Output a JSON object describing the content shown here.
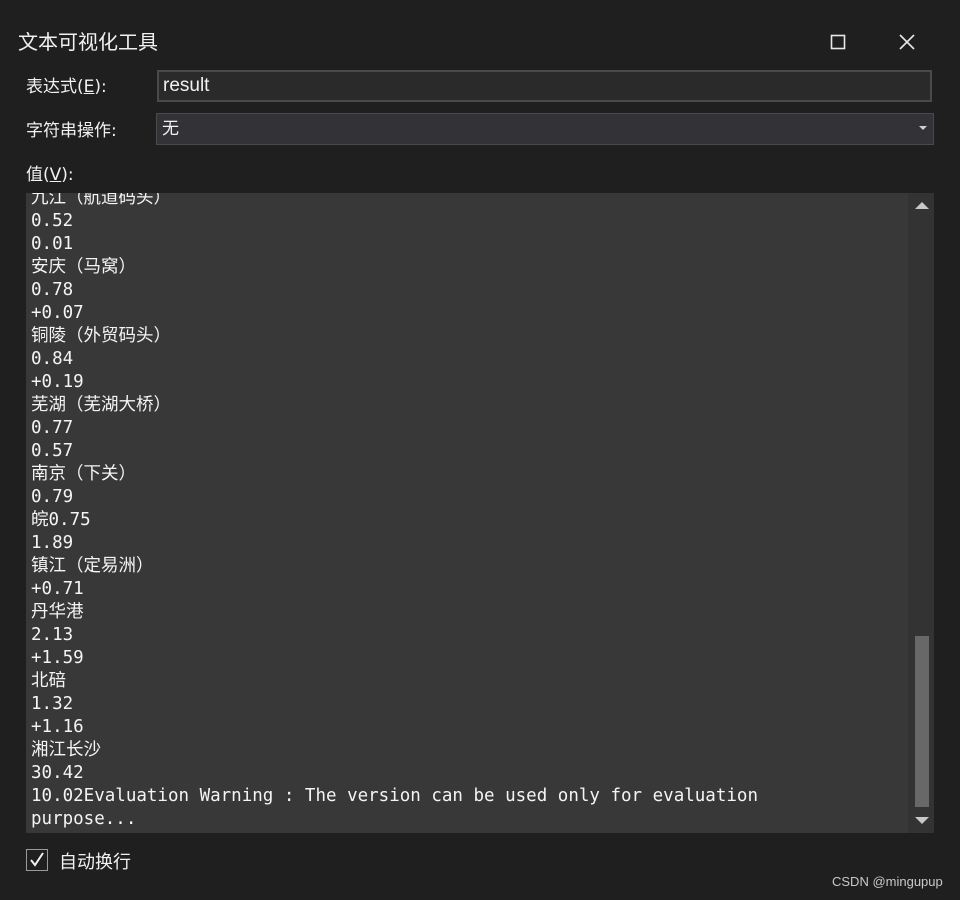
{
  "window": {
    "title": "文本可视化工具",
    "maximize_icon": "maximize-icon",
    "close_icon": "close-icon"
  },
  "expression": {
    "label_prefix": "表达式(",
    "label_accel": "E",
    "label_suffix": "):",
    "value": "result"
  },
  "string_operation": {
    "label": "字符串操作:",
    "selected": "无",
    "dropdown_icon": "chevron-down-icon"
  },
  "value_section": {
    "label_prefix": "值(",
    "label_accel": "V",
    "label_suffix": "):",
    "lines": [
      "九江（航道码头）",
      "0.52",
      "0.01",
      "安庆（马窝）",
      "0.78",
      "+0.07",
      "铜陵（外贸码头）",
      "0.84",
      "+0.19",
      "芜湖（芜湖大桥）",
      "0.77",
      "0.57",
      "南京（下关）",
      "0.79",
      "皖0.75",
      "1.89",
      "镇江（定易洲）",
      "+0.71",
      "丹华港",
      "2.13",
      "+1.59",
      "北碚",
      "1.32",
      "+1.16",
      "湘江长沙",
      "30.42",
      "10.02Evaluation Warning : The version can be used only for evaluation",
      "purpose..."
    ]
  },
  "word_wrap": {
    "label": "自动换行",
    "checked": true
  },
  "watermark": "CSDN @mingupup",
  "colors": {
    "background": "#1f1f1f",
    "text_area": "#383838",
    "scroll_thumb": "#686868"
  }
}
